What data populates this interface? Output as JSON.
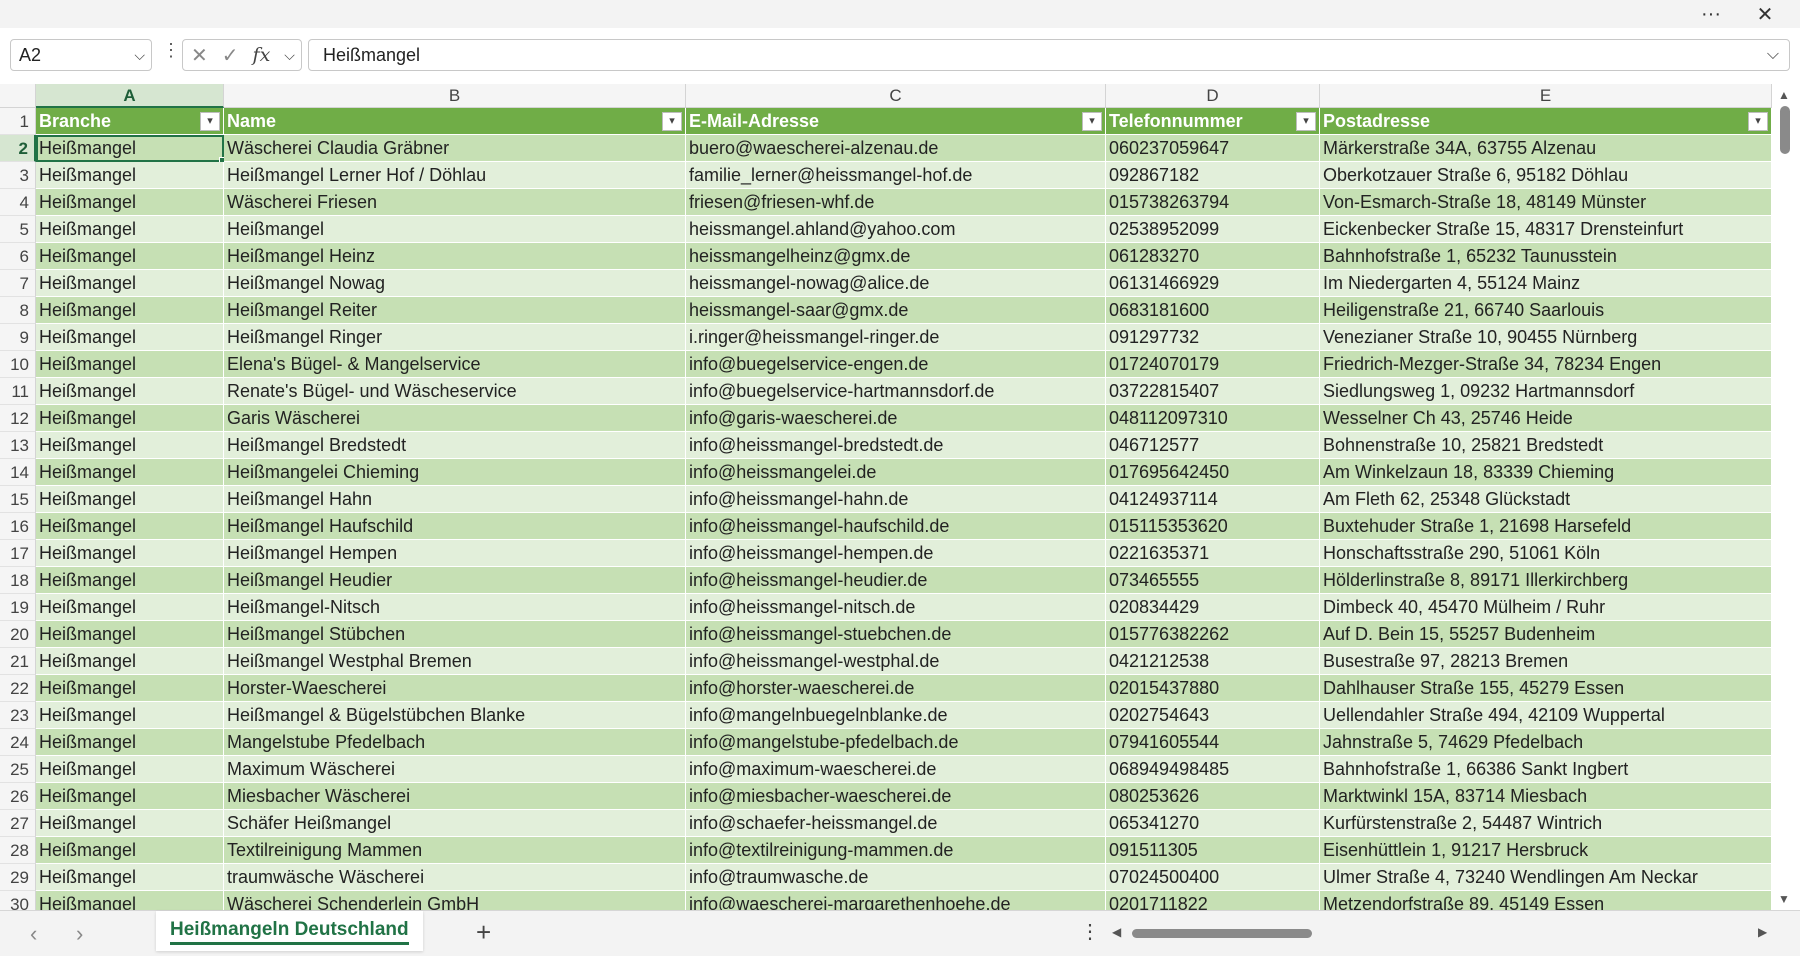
{
  "window": {
    "more_label": "···",
    "close_label": "✕"
  },
  "formula_bar": {
    "name_box": "A2",
    "name_box_chevron": "⌵",
    "dots": "⋮",
    "cancel_glyph": "✕",
    "enter_glyph": "✓",
    "fx_label": "fx",
    "fx_chevron": "⌵",
    "content": "Heißmangel",
    "expand_chevron": "⌵"
  },
  "columns": [
    "A",
    "B",
    "C",
    "D",
    "E"
  ],
  "selected": {
    "column": "A",
    "row": 2
  },
  "table": {
    "header_row_number": "1",
    "headers": [
      "Branche",
      "Name",
      "E-Mail-Adresse",
      "Telefonnummer",
      "Postadresse"
    ],
    "filter_glyph": "▾",
    "rows": [
      {
        "n": "2",
        "cells": [
          "Heißmangel",
          "Wäscherei Claudia Gräbner",
          "buero@waescherei-alzenau.de",
          "060237059647",
          "Märkerstraße 34A, 63755 Alzenau"
        ]
      },
      {
        "n": "3",
        "cells": [
          "Heißmangel",
          "Heißmangel Lerner Hof / Döhlau",
          "familie_lerner@heissmangel-hof.de",
          "092867182",
          "Oberkotzauer Straße 6, 95182 Döhlau"
        ]
      },
      {
        "n": "4",
        "cells": [
          "Heißmangel",
          "Wäscherei Friesen",
          "friesen@friesen-whf.de",
          "015738263794",
          "Von-Esmarch-Straße 18, 48149 Münster"
        ]
      },
      {
        "n": "5",
        "cells": [
          "Heißmangel",
          "Heißmangel",
          "heissmangel.ahland@yahoo.com",
          "02538952099",
          "Eickenbecker Straße 15, 48317 Drensteinfurt"
        ]
      },
      {
        "n": "6",
        "cells": [
          "Heißmangel",
          "Heißmangel Heinz",
          "heissmangelheinz@gmx.de",
          "061283270",
          "Bahnhofstraße 1, 65232 Taunusstein"
        ]
      },
      {
        "n": "7",
        "cells": [
          "Heißmangel",
          "Heißmangel Nowag",
          "heissmangel-nowag@alice.de",
          "06131466929",
          "Im Niedergarten 4, 55124 Mainz"
        ]
      },
      {
        "n": "8",
        "cells": [
          "Heißmangel",
          "Heißmangel Reiter",
          "heissmangel-saar@gmx.de",
          "0683181600",
          "Heiligenstraße 21, 66740 Saarlouis"
        ]
      },
      {
        "n": "9",
        "cells": [
          "Heißmangel",
          "Heißmangel Ringer",
          "i.ringer@heissmangel-ringer.de",
          "091297732",
          "Venezianer Straße 10, 90455 Nürnberg"
        ]
      },
      {
        "n": "10",
        "cells": [
          "Heißmangel",
          "Elena's Bügel- & Mangelservice",
          "info@buegelservice-engen.de",
          "01724070179",
          "Friedrich-Mezger-Straße 34, 78234 Engen"
        ]
      },
      {
        "n": "11",
        "cells": [
          "Heißmangel",
          "Renate's Bügel- und Wäscheservice",
          "info@buegelservice-hartmannsdorf.de",
          "03722815407",
          "Siedlungsweg 1, 09232 Hartmannsdorf"
        ]
      },
      {
        "n": "12",
        "cells": [
          "Heißmangel",
          "Garis Wäscherei",
          "info@garis-waescherei.de",
          "048112097310",
          "Wesselner Ch 43, 25746 Heide"
        ]
      },
      {
        "n": "13",
        "cells": [
          "Heißmangel",
          "Heißmangel Bredstedt",
          "info@heissmangel-bredstedt.de",
          "046712577",
          "Bohnenstraße 10, 25821 Bredstedt"
        ]
      },
      {
        "n": "14",
        "cells": [
          "Heißmangel",
          "Heißmangelei Chieming",
          "info@heissmangelei.de",
          "017695642450",
          "Am Winkelzaun 18, 83339 Chieming"
        ]
      },
      {
        "n": "15",
        "cells": [
          "Heißmangel",
          "Heißmangel Hahn",
          "info@heissmangel-hahn.de",
          "04124937114",
          "Am Fleth 62, 25348 Glückstadt"
        ]
      },
      {
        "n": "16",
        "cells": [
          "Heißmangel",
          "Heißmangel Haufschild",
          "info@heissmangel-haufschild.de",
          "015115353620",
          "Buxtehuder Straße 1, 21698 Harsefeld"
        ]
      },
      {
        "n": "17",
        "cells": [
          "Heißmangel",
          "Heißmangel Hempen",
          "info@heissmangel-hempen.de",
          "0221635371",
          "Honschaftsstraße 290, 51061 Köln"
        ]
      },
      {
        "n": "18",
        "cells": [
          "Heißmangel",
          "Heißmangel Heudier",
          "info@heissmangel-heudier.de",
          "073465555",
          "Hölderlinstraße 8, 89171 Illerkirchberg"
        ]
      },
      {
        "n": "19",
        "cells": [
          "Heißmangel",
          "Heißmangel-Nitsch",
          "info@heissmangel-nitsch.de",
          "020834429",
          "Dimbeck 40, 45470 Mülheim / Ruhr"
        ]
      },
      {
        "n": "20",
        "cells": [
          "Heißmangel",
          "Heißmangel Stübchen",
          "info@heissmangel-stuebchen.de",
          "015776382262",
          "Auf D. Bein 15, 55257 Budenheim"
        ]
      },
      {
        "n": "21",
        "cells": [
          "Heißmangel",
          "Heißmangel Westphal Bremen",
          "info@heissmangel-westphal.de",
          "0421212538",
          "Busestraße 97, 28213 Bremen"
        ]
      },
      {
        "n": "22",
        "cells": [
          "Heißmangel",
          "Horster-Waescherei",
          "info@horster-waescherei.de",
          "02015437880",
          "Dahlhauser Straße 155, 45279 Essen"
        ]
      },
      {
        "n": "23",
        "cells": [
          "Heißmangel",
          "Heißmangel & Bügelstübchen Blanke",
          "info@mangelnbuegelnblanke.de",
          "0202754643",
          "Uellendahler Straße 494, 42109 Wuppertal"
        ]
      },
      {
        "n": "24",
        "cells": [
          "Heißmangel",
          "Mangelstube Pfedelbach",
          "info@mangelstube-pfedelbach.de",
          "07941605544",
          "Jahnstraße 5, 74629 Pfedelbach"
        ]
      },
      {
        "n": "25",
        "cells": [
          "Heißmangel",
          "Maximum Wäscherei",
          "info@maximum-waescherei.de",
          "068949498485",
          "Bahnhofstraße 1, 66386 Sankt Ingbert"
        ]
      },
      {
        "n": "26",
        "cells": [
          "Heißmangel",
          "Miesbacher Wäscherei",
          "info@miesbacher-waescherei.de",
          "080253626",
          "Marktwinkl 15A, 83714 Miesbach"
        ]
      },
      {
        "n": "27",
        "cells": [
          "Heißmangel",
          "Schäfer Heißmangel",
          "info@schaefer-heissmangel.de",
          "065341270",
          "Kurfürstenstraße 2, 54487 Wintrich"
        ]
      },
      {
        "n": "28",
        "cells": [
          "Heißmangel",
          "Textilreinigung Mammen",
          "info@textilreinigung-mammen.de",
          "091511305",
          "Eisenhüttlein 1, 91217 Hersbruck"
        ]
      },
      {
        "n": "29",
        "cells": [
          "Heißmangel",
          "traumwäsche Wäscherei",
          "info@traumwasche.de",
          "07024500400",
          "Ulmer Straße 4, 73240 Wendlingen Am Neckar"
        ]
      },
      {
        "n": "30",
        "cells": [
          "Heißmangel",
          "Wäscherei Schenderlein GmbH",
          "info@waescherei-margarethenhoehe.de",
          "0201711822",
          "Metzendorfstraße 89, 45149 Essen"
        ]
      }
    ]
  },
  "sheets": {
    "active": "Heißmangeln Deutschland",
    "add_label": "+",
    "prev_glyph": "‹",
    "next_glyph": "›",
    "more_glyph": "⋮"
  },
  "scroll": {
    "up": "▲",
    "down": "▼",
    "left": "◀",
    "right": "▶"
  },
  "colors": {
    "header_green": "#70ad47",
    "band_dark": "#c6e0b4",
    "band_light": "#e2efda",
    "accent": "#217346"
  }
}
